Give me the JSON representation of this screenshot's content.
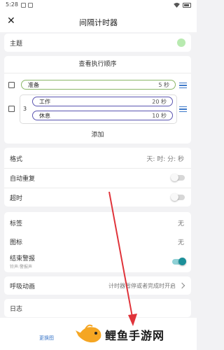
{
  "status": {
    "time": "5:28"
  },
  "app": {
    "title": "间隔计时器"
  },
  "settings": {
    "theme_label": "主题",
    "theme_color": "#b8eab0",
    "view_order": "查看执行顺序",
    "steps": [
      {
        "name": "准备",
        "duration": "5 秒",
        "border": "#8bb768"
      },
      {
        "name": "工作",
        "duration": "20 秒",
        "border": "#5b55b0"
      },
      {
        "name": "休息",
        "duration": "10 秒",
        "border": "#5b55b0"
      }
    ],
    "repeat_count": "3",
    "add": "添加",
    "format_label": "格式",
    "format_value": "天: 时: 分: 秒",
    "auto_repeat": "自动重复",
    "auto_repeat_on": false,
    "overtime": "超时",
    "overtime_on": false,
    "tag_label": "标签",
    "tag_value": "无",
    "icon_label": "图标",
    "icon_value": "无",
    "end_alert": "结束警报",
    "end_alert_sub": "铃声:警报声",
    "end_alert_on": true,
    "breath_label": "呼吸动画",
    "breath_value": "计时器暂停或者完成时开启",
    "log_label": "日志"
  },
  "bottom": {
    "link": "更换图",
    "ad_text": "鲤鱼手游网"
  }
}
